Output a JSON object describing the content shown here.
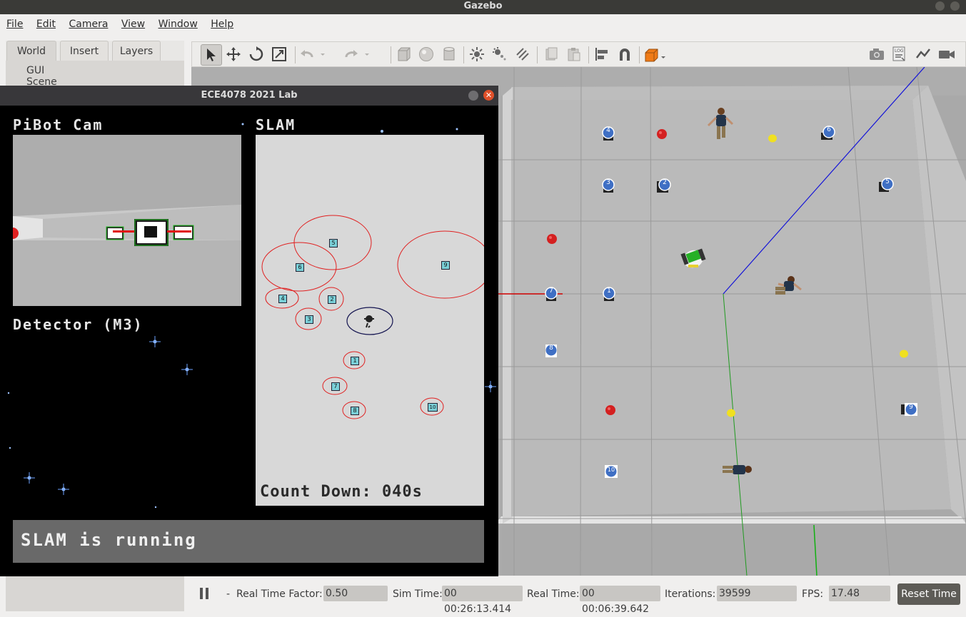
{
  "app": {
    "title": "Gazebo"
  },
  "menu": [
    "File",
    "Edit",
    "Camera",
    "View",
    "Window",
    "Help"
  ],
  "left_panel": {
    "tabs": [
      "World",
      "Insert",
      "Layers"
    ],
    "tree": [
      "GUI",
      "Scene"
    ]
  },
  "toolbar": {
    "tools": [
      "select-icon",
      "translate-icon",
      "rotate-icon",
      "scale-icon",
      "undo-icon",
      "redo-icon",
      "box-icon",
      "sphere-icon",
      "cylinder-icon",
      "point-light-icon",
      "spot-light-icon",
      "directional-light-icon",
      "copy-icon",
      "paste-icon",
      "align-icon",
      "snap-icon",
      "view-angle-icon",
      "screenshot-icon",
      "log-icon",
      "plot-icon",
      "record-icon"
    ]
  },
  "statusbar": {
    "real_time_factor_label": "Real Time Factor:",
    "real_time_factor": "0.50",
    "sim_time_label": "Sim Time:",
    "sim_time": "00 00:26:13.414",
    "real_time_label": "Real Time:",
    "real_time": "00 00:06:39.642",
    "iterations_label": "Iterations:",
    "iterations": "39599",
    "fps_label": "FPS:",
    "fps": "17.48",
    "reset_label": "Reset Time",
    "pause_dash": "-"
  },
  "lab_window": {
    "title": "ECE4078 2021 Lab",
    "cam_title": "PiBot Cam",
    "slam_title": "SLAM",
    "detector_title": "Detector (M3)",
    "countdown": "Count Down: 040s",
    "status": "SLAM is running",
    "slam_markers": [
      {
        "id": "5"
      },
      {
        "id": "6"
      },
      {
        "id": "9"
      },
      {
        "id": "4"
      },
      {
        "id": "2"
      },
      {
        "id": "3"
      },
      {
        "id": "1"
      },
      {
        "id": "7"
      },
      {
        "id": "8"
      },
      {
        "id": "10"
      }
    ]
  },
  "world_markers": [
    "4",
    "6",
    "3",
    "2",
    "5",
    "7",
    "1",
    "8",
    "9",
    "10"
  ],
  "colors": {
    "accent_red": "#d62020",
    "marker_blue": "#3f6fc4",
    "status_bg": "#696969"
  }
}
